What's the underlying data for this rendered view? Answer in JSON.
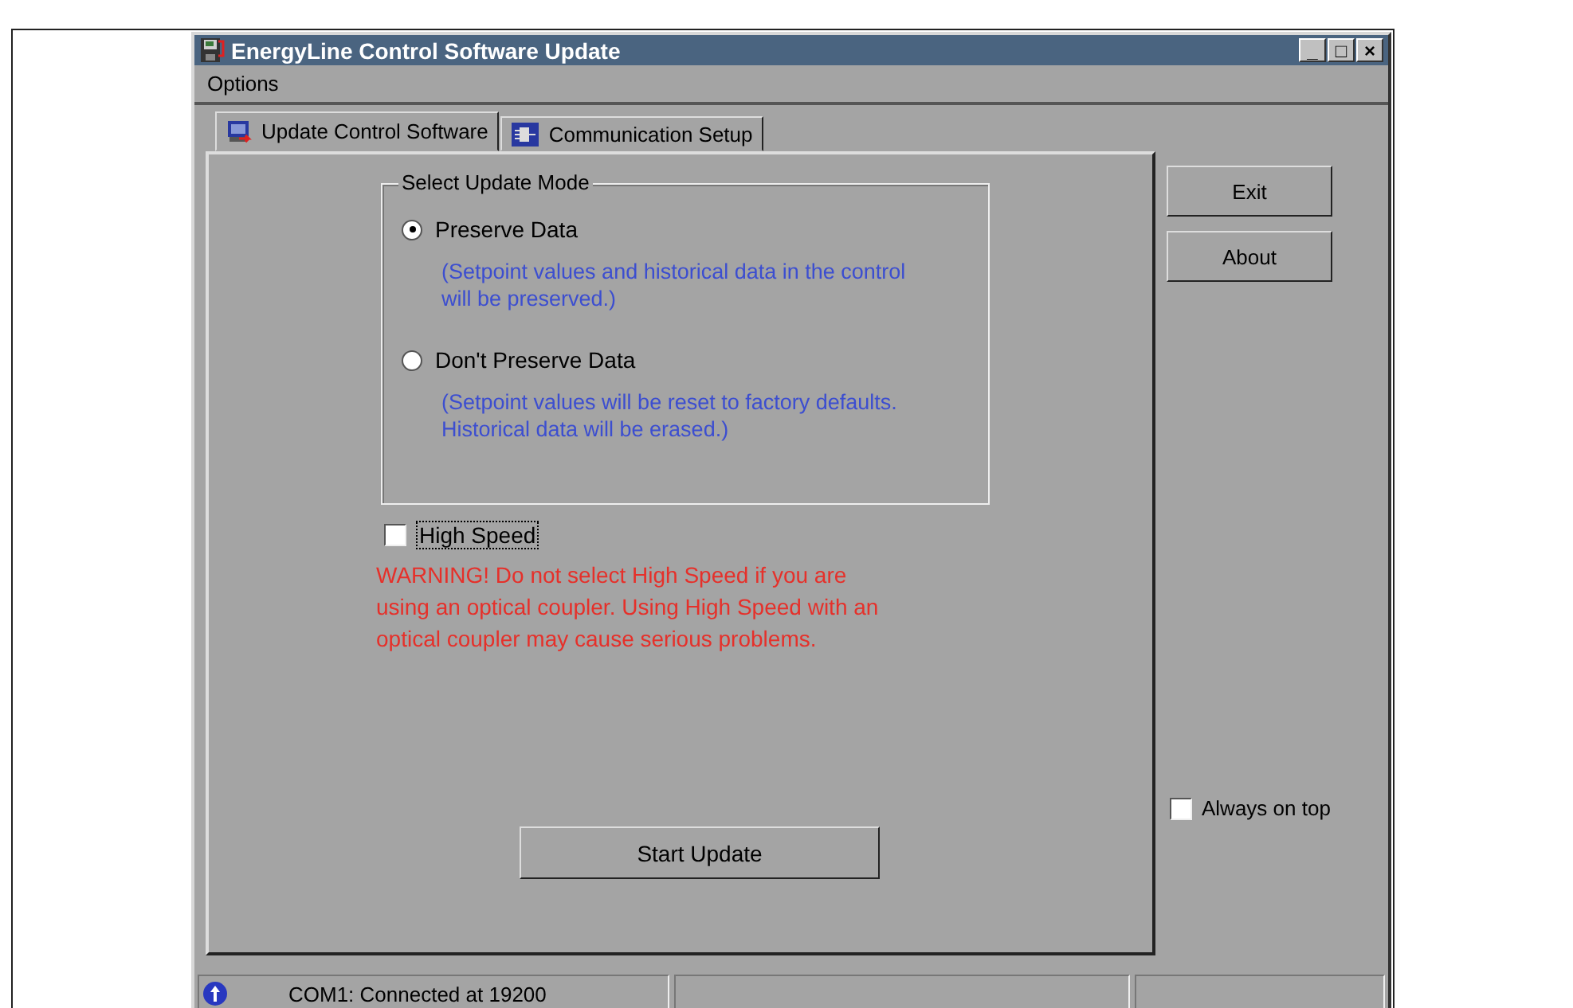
{
  "window": {
    "title": "EnergyLine Control Software Update",
    "controls": [
      "_",
      "□",
      "×"
    ]
  },
  "menu": [
    {
      "label": "Options"
    }
  ],
  "tabs": [
    {
      "label": "Update Control Software",
      "selected": true
    },
    {
      "label": "Communication Setup",
      "selected": false
    }
  ],
  "update_mode": {
    "title": "Select Update Mode",
    "options": [
      {
        "label": "Preserve Data",
        "selected": true,
        "description": "(Setpoint values and historical data in the control will be preserved.)"
      },
      {
        "label": "Don't Preserve Data",
        "selected": false,
        "description": "(Setpoint values will be reset to factory defaults. Historical data will be erased.)"
      }
    ]
  },
  "high_speed": {
    "label": "High Speed",
    "checked": false
  },
  "warning": "WARNING!  Do not select High Speed if you are using an optical coupler. Using High Speed with an optical coupler may cause serious problems.",
  "start_button": "Start Update",
  "side_buttons": [
    "Exit",
    "About"
  ],
  "always_on_top": {
    "label": "Always on top",
    "checked": false
  },
  "status_bar": {
    "text": "COM1: Connected at 19200"
  }
}
